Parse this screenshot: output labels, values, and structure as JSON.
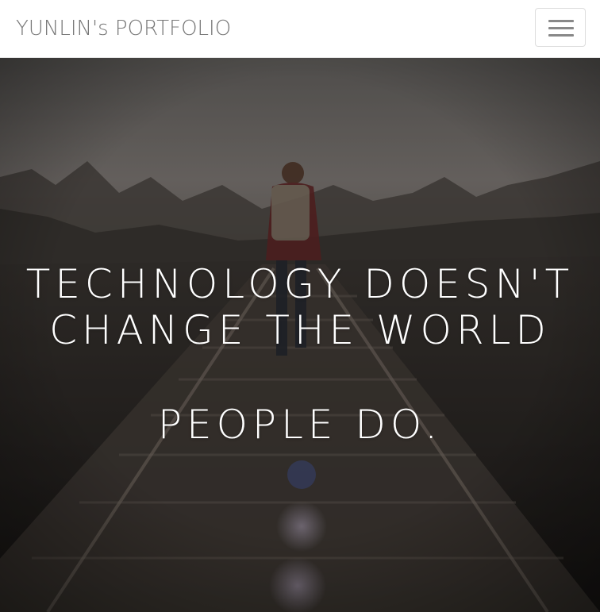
{
  "navbar": {
    "brand": "YUNLIN's PORTFOLIO",
    "menu_icon": "hamburger-icon"
  },
  "hero": {
    "line1": "TECHNOLOGY DOESN'T",
    "line2": "CHANGE THE WORLD",
    "line3": "PEOPLE DO.",
    "background": "photo of person walking on railroad tracks"
  },
  "colors": {
    "brand_text": "#777777",
    "hero_text": "#ffffff",
    "toggle_bar": "#888888"
  }
}
